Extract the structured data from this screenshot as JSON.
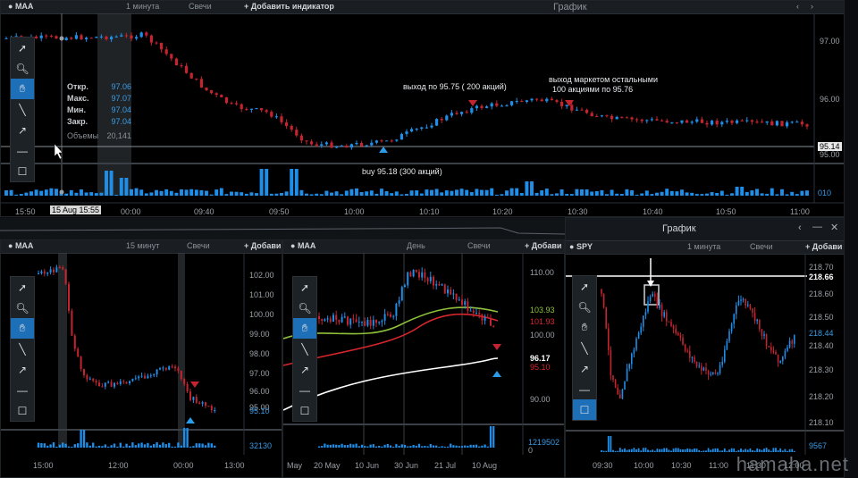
{
  "main": {
    "symbol": "MAA",
    "interval": "1 минута",
    "chart_type": "Свечи",
    "add_indicator": "+ Добавить индикатор",
    "window_title": "График",
    "price_axis": [
      "97.00",
      "96.00",
      "95.00"
    ],
    "current_price": "95.14",
    "volume_axis": "010",
    "time_axis": [
      "15:50",
      "00:00",
      "09:40",
      "09:50",
      "10:00",
      "10:10",
      "10:20",
      "10:30",
      "10:40",
      "10:50",
      "11:00"
    ],
    "time_highlight": "15 Aug 15:55",
    "info": {
      "open_label": "Откр.",
      "open": "97.06",
      "high_label": "Макс.",
      "high": "97.07",
      "low_label": "Мин.",
      "low": "97.04",
      "close_label": "Закр.",
      "close": "97.04",
      "volume_label": "Объемы",
      "volume": "20,141"
    },
    "annotations": {
      "exit1": "выход по 95.75 ( 200 акций)",
      "exit2_line1": "выход маркетом остальными",
      "exit2_line2": "100 акциями по 95.76",
      "buy": "buy 95.18 (300 акций)"
    }
  },
  "panel_15m": {
    "symbol": "MAA",
    "interval": "15 минут",
    "chart_type": "Свечи",
    "add": "+ Добави",
    "price_axis": [
      "102.00",
      "101.00",
      "100.00",
      "99.00",
      "98.00",
      "97.00",
      "96.00",
      "95.00"
    ],
    "current_price": "95.10",
    "volume_axis": "32130",
    "time_axis": [
      "15:00",
      "12:00",
      "00:00",
      "13:00"
    ]
  },
  "panel_day": {
    "symbol": "MAA",
    "interval": "День",
    "chart_type": "Свечи",
    "add": "+ Добави",
    "price_axis": [
      "110.00",
      "100.00",
      "90.00"
    ],
    "ma_labels": [
      "103.93",
      "101.93"
    ],
    "current_price": "96.17",
    "sub_price": "95.10",
    "volume_axis": "1219502",
    "volume_zero": "0",
    "time_axis": [
      "May",
      "20 May",
      "10 Jun",
      "30 Jun",
      "21 Jul",
      "10 Aug"
    ]
  },
  "panel_spy": {
    "window_title": "График",
    "symbol": "SPY",
    "interval": "1 минута",
    "chart_type": "Свечи",
    "add": "+ Добави",
    "price_axis": [
      "218.70",
      "218.60",
      "218.50",
      "218.40",
      "218.30",
      "218.20",
      "218.10"
    ],
    "price_line": "218.66",
    "current_price": "218.44",
    "volume_axis": "9567",
    "time_axis": [
      "09:30",
      "10:00",
      "10:30",
      "11:00",
      "11:30",
      "12:00"
    ]
  },
  "watermark": "hamaha.net",
  "colors": {
    "up": "#1f8ee8",
    "down": "#c4242f",
    "accent": "#1d6fb8",
    "ma_green": "#8fc23a",
    "ma_red": "#d8262e",
    "ma_white": "#ffffff"
  }
}
